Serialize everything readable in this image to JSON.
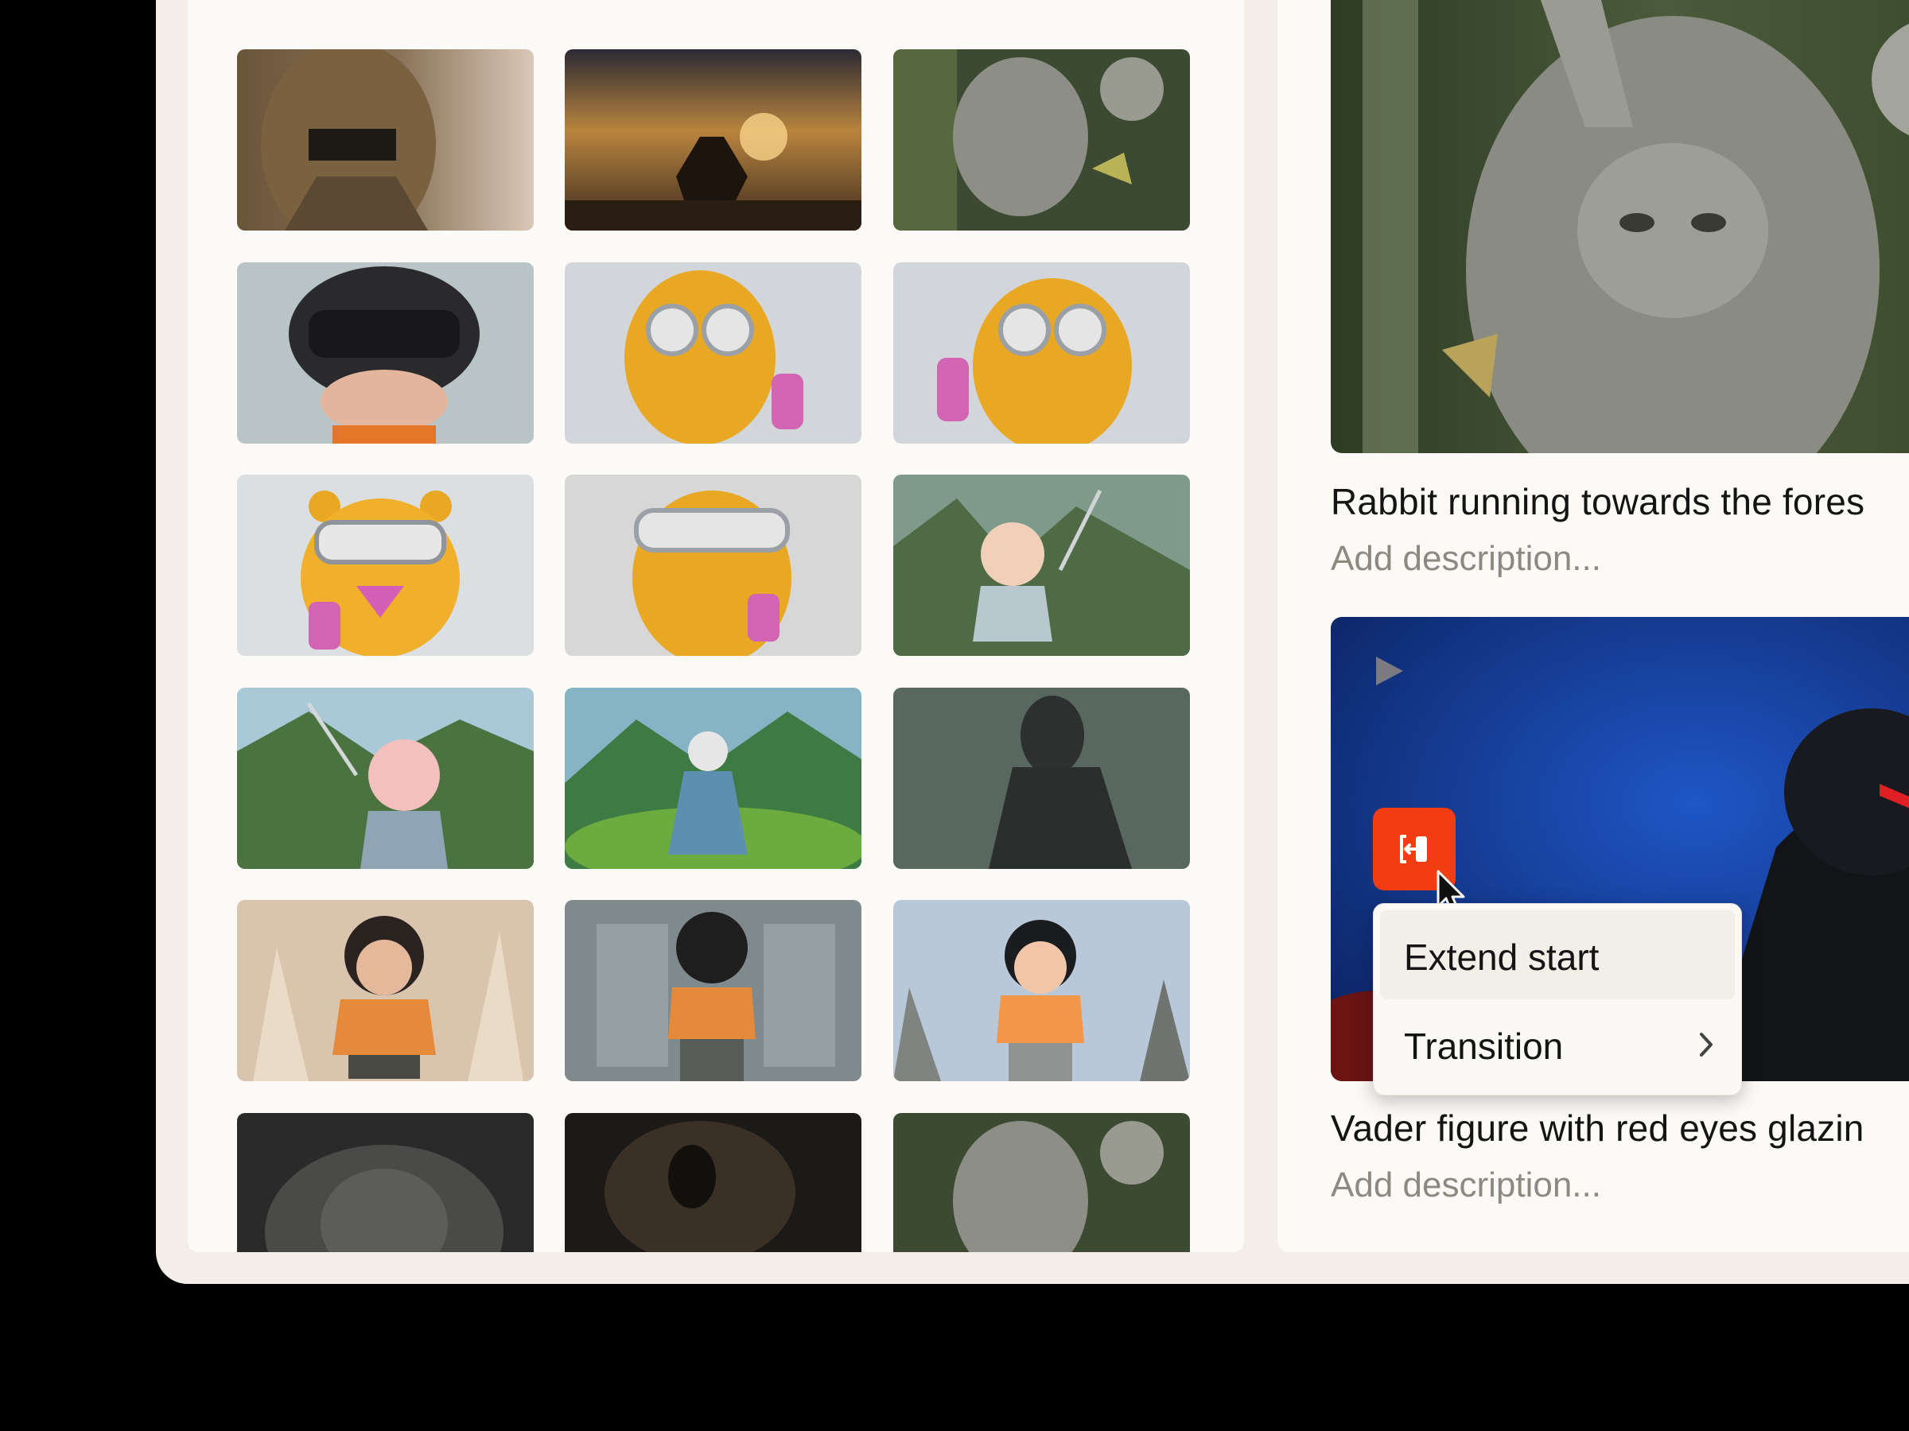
{
  "clips": [
    {
      "title": "Rabbit running towards the fores",
      "description_placeholder": "Add description..."
    },
    {
      "title": "Vader figure with red eyes glazin",
      "description_placeholder": "Add description..."
    }
  ],
  "context_menu": {
    "items": [
      {
        "label": "Extend start",
        "icon": "",
        "active": true
      },
      {
        "label": "Transition",
        "icon": "chevron-right-icon",
        "active": false
      }
    ]
  },
  "icons": {
    "play": "play-icon",
    "extend": "extend-start-icon",
    "cursor": "cursor-icon"
  },
  "colors": {
    "accent": "#f23c12",
    "panel": "#fcfaf7",
    "frame": "#f3eee7",
    "muted_text": "#8d8880"
  }
}
